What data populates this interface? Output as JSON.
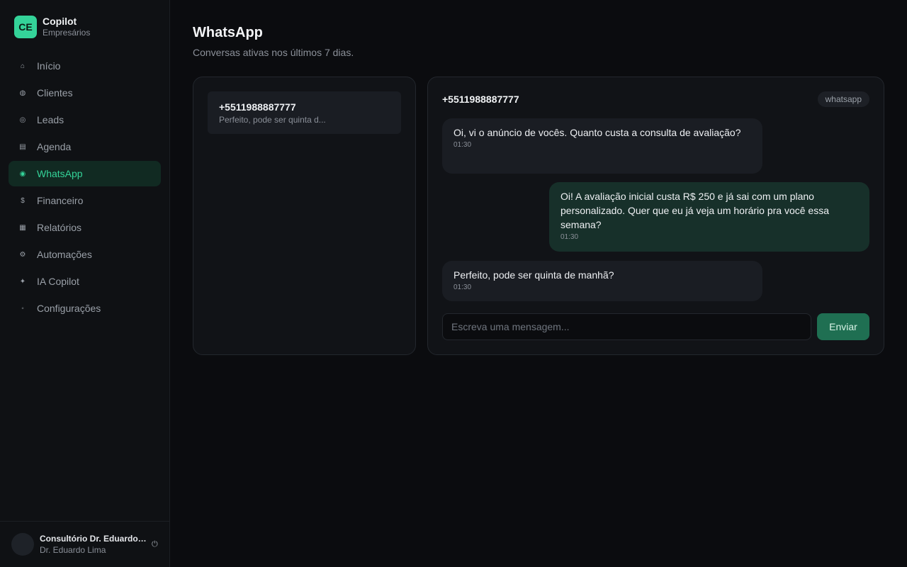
{
  "brand": {
    "logo": "CE",
    "title": "Copilot",
    "subtitle": "Empresários"
  },
  "nav": [
    {
      "label": "Início",
      "icon": "⌂",
      "icon_name": "home-icon"
    },
    {
      "label": "Clientes",
      "icon": "◍",
      "icon_name": "clients-icon"
    },
    {
      "label": "Leads",
      "icon": "◎",
      "icon_name": "target-icon"
    },
    {
      "label": "Agenda",
      "icon": "▤",
      "icon_name": "calendar-icon"
    },
    {
      "label": "WhatsApp",
      "icon": "◉",
      "icon_name": "whatsapp-icon",
      "active": true
    },
    {
      "label": "Financeiro",
      "icon": "$",
      "icon_name": "dollar-icon"
    },
    {
      "label": "Relatórios",
      "icon": "▦",
      "icon_name": "reports-icon"
    },
    {
      "label": "Automações",
      "icon": "⚙",
      "icon_name": "automation-icon"
    },
    {
      "label": "IA Copilot",
      "icon": "✦",
      "icon_name": "sparkle-icon"
    },
    {
      "label": "Configurações",
      "icon": "◦",
      "icon_name": "settings-icon"
    }
  ],
  "user": {
    "name": "Consultório Dr. Eduardo Lima",
    "subtitle": "Dr. Eduardo Lima",
    "logout_icon": "⏻"
  },
  "page": {
    "title": "WhatsApp",
    "subtitle": "Conversas ativas nos últimos 7 dias."
  },
  "conversations": [
    {
      "phone": "+5511988887777",
      "preview": "Perfeito, pode ser quinta d..."
    }
  ],
  "chat": {
    "phone": "+5511988887777",
    "channel": "whatsapp",
    "messages": [
      {
        "direction": "in",
        "text": "Oi, vi o anúncio de vocês. Quanto custa a consulta de avaliação?",
        "time": "01:30"
      },
      {
        "direction": "out",
        "text": "Oi! A avaliação inicial custa R$ 250 e já sai com um plano personalizado. Quer que eu já veja um horário pra você essa semana?",
        "time": "01:30"
      },
      {
        "direction": "in",
        "text": "Perfeito, pode ser quinta de manhã?",
        "time": "01:30"
      }
    ],
    "composer_placeholder": "Escreva uma mensagem...",
    "send_label": "Enviar"
  },
  "colors": {
    "accent": "#34d399",
    "background": "#0b0c0f",
    "panel": "#111317",
    "outgoing_bubble": "#17302a",
    "send_button": "#1f6f52"
  }
}
